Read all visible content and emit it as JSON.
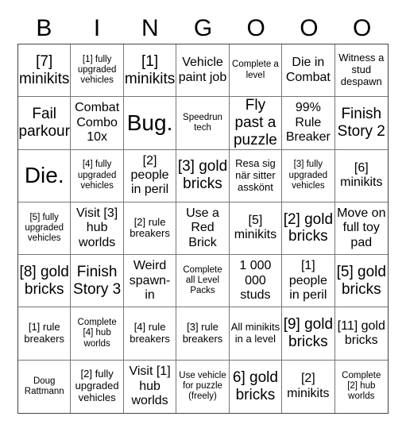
{
  "title_letters": [
    "B",
    "I",
    "N",
    "G",
    "O",
    "O",
    "O"
  ],
  "rows": [
    [
      {
        "text": "[7] minikits",
        "size": "lg"
      },
      {
        "text": "[1] fully upgraded vehicles",
        "size": "xs"
      },
      {
        "text": "[1] minikits",
        "size": "lg"
      },
      {
        "text": "Vehicle paint job",
        "size": "md"
      },
      {
        "text": "Complete a level",
        "size": "xs"
      },
      {
        "text": "Die in Combat",
        "size": "md"
      },
      {
        "text": "Witness a stud despawn",
        "size": "sm"
      }
    ],
    [
      {
        "text": "Fail parkour",
        "size": "lg"
      },
      {
        "text": "Combat Combo 10x",
        "size": "md"
      },
      {
        "text": "Bug.",
        "size": "xl"
      },
      {
        "text": "Speedrun tech",
        "size": "xs"
      },
      {
        "text": "Fly past a puzzle",
        "size": "lg"
      },
      {
        "text": "99% Rule Breaker",
        "size": "md"
      },
      {
        "text": "Finish Story 2",
        "size": "lg"
      }
    ],
    [
      {
        "text": "Die.",
        "size": "xl"
      },
      {
        "text": "[4] fully upgraded vehicles",
        "size": "xs"
      },
      {
        "text": "[2] people in peril",
        "size": "md"
      },
      {
        "text": "[3] gold bricks",
        "size": "lg"
      },
      {
        "text": "Resa sig när sitter asskönt",
        "size": "sm"
      },
      {
        "text": "[3] fully upgraded vehicles",
        "size": "xs"
      },
      {
        "text": "[6] minikits",
        "size": "md"
      }
    ],
    [
      {
        "text": "[5] fully upgraded vehicles",
        "size": "xs"
      },
      {
        "text": "Visit [3] hub worlds",
        "size": "md"
      },
      {
        "text": "[2] rule breakers",
        "size": "sm"
      },
      {
        "text": "Use a Red Brick",
        "size": "md"
      },
      {
        "text": "[5] minikits",
        "size": "md"
      },
      {
        "text": "[2] gold bricks",
        "size": "lg"
      },
      {
        "text": "Move on full toy pad",
        "size": "md"
      }
    ],
    [
      {
        "text": "[8] gold bricks",
        "size": "lg"
      },
      {
        "text": "Finish Story 3",
        "size": "lg"
      },
      {
        "text": "Weird spawn-in",
        "size": "md"
      },
      {
        "text": "Complete all Level Packs",
        "size": "xs"
      },
      {
        "text": "1 000 000 studs",
        "size": "md"
      },
      {
        "text": "[1] people in peril",
        "size": "md"
      },
      {
        "text": "[5] gold bricks",
        "size": "lg"
      }
    ],
    [
      {
        "text": "[1] rule breakers",
        "size": "sm"
      },
      {
        "text": "Complete [4] hub worlds",
        "size": "xs"
      },
      {
        "text": "[4] rule breakers",
        "size": "sm"
      },
      {
        "text": "[3] rule breakers",
        "size": "sm"
      },
      {
        "text": "All minikits in a level",
        "size": "sm"
      },
      {
        "text": "[9] gold bricks",
        "size": "lg"
      },
      {
        "text": "[11] gold bricks",
        "size": "md"
      }
    ],
    [
      {
        "text": "Doug Rattmann",
        "size": "xs"
      },
      {
        "text": "[2] fully upgraded vehicles",
        "size": "sm"
      },
      {
        "text": "Visit [1] hub worlds",
        "size": "md"
      },
      {
        "text": "Use vehicle for puzzle (freely)",
        "size": "xs"
      },
      {
        "text": "6] gold bricks",
        "size": "lg"
      },
      {
        "text": "[2] minikits",
        "size": "md"
      },
      {
        "text": "Complete [2] hub worlds",
        "size": "xs"
      }
    ]
  ]
}
